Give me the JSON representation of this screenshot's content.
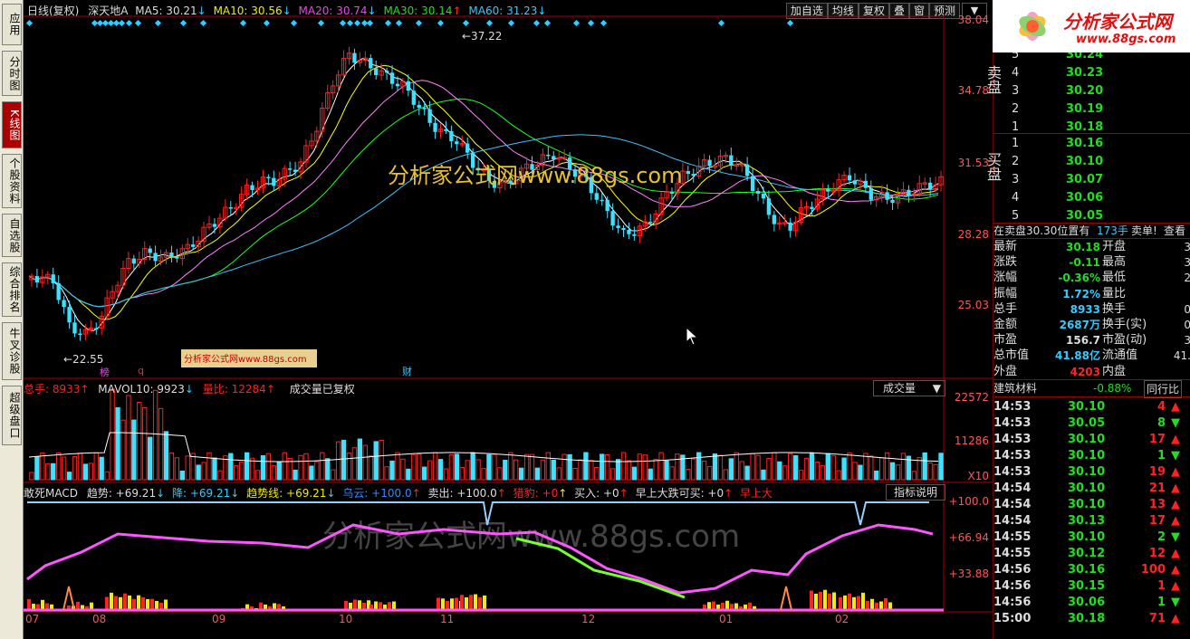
{
  "left_tabs": [
    {
      "label": "应用",
      "active": false
    },
    {
      "label": "分时图",
      "active": false
    },
    {
      "label": "K线图",
      "active": true
    },
    {
      "label": "个股资料",
      "active": false
    },
    {
      "label": "自选股",
      "active": false
    },
    {
      "label": "综合排名",
      "active": false
    },
    {
      "label": "牛叉诊股",
      "active": false
    },
    {
      "label": "超级盘口",
      "active": false
    }
  ],
  "header": {
    "period": "日线(复权)",
    "stock": "深天地A",
    "ma5": "MA5: 30.21",
    "ma10": "MA10: 30.56",
    "ma20": "MA20: 30.74",
    "ma30": "MA30: 30.14",
    "ma60": "MA60: 31.23"
  },
  "toolbar": [
    "加自选",
    "均线",
    "复权",
    "叠",
    "窗",
    "预测"
  ],
  "price_axis": [
    "38.04",
    "34.78",
    "31.53",
    "28.28",
    "25.03"
  ],
  "annotations": {
    "high": "37.22",
    "low": "22.55",
    "mark1": "榜",
    "mark2": "q",
    "mark3": "财",
    "watermark_small": "分析家公式网www.88gs.com",
    "watermark_mid": "分析家公式网www.88gs.com",
    "watermark_big": "分析家公式网www.88gs.com"
  },
  "vol_header": {
    "total": "总手: 8933",
    "mavol": "MAVOL10: 9923",
    "ratio": "量比: 12284",
    "note": "成交量已复权",
    "select": "成交量"
  },
  "vol_axis": [
    "22572",
    "11286",
    "X10"
  ],
  "macd_header": {
    "name": "敢死MACD",
    "trend": "趋势: +69.21",
    "down": "降: +69.21",
    "trendline": "趋势线: +69.21",
    "cloud": "乌云: +100.0",
    "sell": "卖出: +100.0",
    "hunt": "猎豹: +0",
    "buy": "买入: +0",
    "dip": "早上大跌可买: +0",
    "early": "早上大",
    "help": "指标说明"
  },
  "macd_axis": [
    "+100.0",
    "+66.94",
    "+33.88"
  ],
  "months": [
    "07",
    "08",
    "09",
    "10",
    "11",
    "12",
    "01",
    "02"
  ],
  "right": {
    "logo_text": "分析家公式网",
    "logo_url": "www.88gs.com",
    "wei": "委",
    "sell_label": "卖盘",
    "buy_label": "买盘",
    "sell": [
      {
        "n": "5",
        "p": "30.24"
      },
      {
        "n": "4",
        "p": "30.23"
      },
      {
        "n": "3",
        "p": "30.20"
      },
      {
        "n": "2",
        "p": "30.19"
      },
      {
        "n": "1",
        "p": "30.18"
      }
    ],
    "buy": [
      {
        "n": "1",
        "p": "30.16"
      },
      {
        "n": "2",
        "p": "30.10"
      },
      {
        "n": "3",
        "p": "30.07"
      },
      {
        "n": "4",
        "p": "30.06"
      },
      {
        "n": "5",
        "p": "30.05"
      }
    ],
    "notice": "在卖盘30.30位置有",
    "notice2": "173手",
    "notice3": "卖单!",
    "notice4": "查看",
    "quote": [
      {
        "k": "最新",
        "v": "30.18",
        "k2": "开盘",
        "v2": "3"
      },
      {
        "k": "涨跌",
        "v": "-0.11",
        "k2": "最高",
        "v2": "3"
      },
      {
        "k": "涨幅",
        "v": "-0.36%",
        "k2": "最低",
        "v2": "2"
      },
      {
        "k": "振幅",
        "v": "1.72%",
        "k2": "量比",
        "v2": ""
      },
      {
        "k": "总手",
        "v": "8933",
        "k2": "换手",
        "v2": "0"
      },
      {
        "k": "金额",
        "v": "2687万",
        "k2": "换手(实)",
        "v2": "0"
      },
      {
        "k": "市盈",
        "v": "156.7",
        "k2": "市盈(动)",
        "v2": "3"
      },
      {
        "k": "总市值",
        "v": "41.88亿",
        "k2": "流通值",
        "v2": "41."
      },
      {
        "k": "外盘",
        "v": "4203",
        "k2": "内盘",
        "v2": ""
      }
    ],
    "sector": "建筑材料",
    "sector_chg": "-0.88%",
    "sector_tab": "同行比",
    "ticks": [
      {
        "t": "14:53",
        "p": "30.10",
        "v": "4",
        "d": "up"
      },
      {
        "t": "14:53",
        "p": "30.05",
        "v": "8",
        "d": "down"
      },
      {
        "t": "14:53",
        "p": "30.10",
        "v": "17",
        "d": "up"
      },
      {
        "t": "14:53",
        "p": "30.10",
        "v": "1",
        "d": "down"
      },
      {
        "t": "14:53",
        "p": "30.10",
        "v": "19",
        "d": "up"
      },
      {
        "t": "14:54",
        "p": "30.10",
        "v": "21",
        "d": "up"
      },
      {
        "t": "14:54",
        "p": "30.10",
        "v": "13",
        "d": "up"
      },
      {
        "t": "14:54",
        "p": "30.13",
        "v": "17",
        "d": "up"
      },
      {
        "t": "14:55",
        "p": "30.10",
        "v": "2",
        "d": "down"
      },
      {
        "t": "14:55",
        "p": "30.12",
        "v": "12",
        "d": "up"
      },
      {
        "t": "14:56",
        "p": "30.16",
        "v": "100",
        "d": "up"
      },
      {
        "t": "14:56",
        "p": "30.15",
        "v": "1",
        "d": "up"
      },
      {
        "t": "14:56",
        "p": "30.06",
        "v": "1",
        "d": "down"
      },
      {
        "t": "15:00",
        "p": "30.18",
        "v": "71",
        "d": "up"
      }
    ]
  },
  "colors": {
    "up": "#ff2020",
    "down": "#40e0ff",
    "ma5": "#ffffff",
    "ma10": "#ffff00",
    "ma20": "#ff80ff",
    "ma30": "#20ff20",
    "ma60": "#40c0ff",
    "border": "#a00000"
  }
}
